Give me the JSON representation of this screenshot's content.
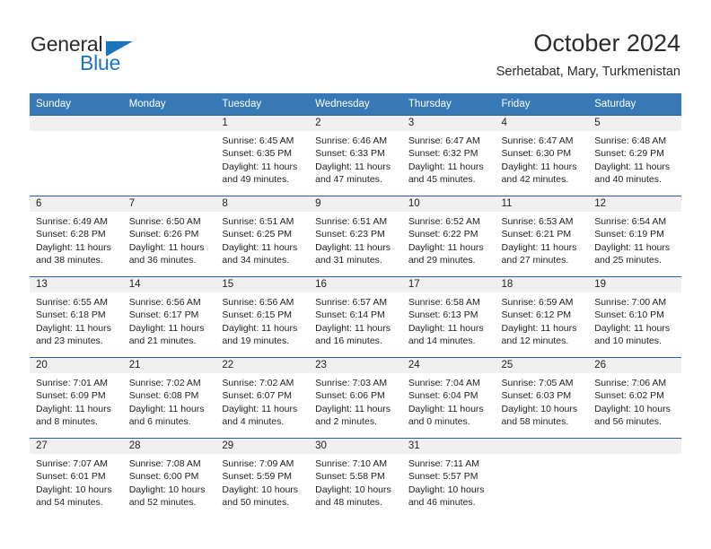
{
  "brand": {
    "name_part1": "General",
    "name_part2": "Blue",
    "accent_color": "#1b75bb"
  },
  "header": {
    "month_title": "October 2024",
    "location": "Serhetabat, Mary, Turkmenistan"
  },
  "theme": {
    "header_row_bg": "#3679b6",
    "daynum_band_bg": "#f0f0f0",
    "grid_line": "#2a6099",
    "text": "#222222"
  },
  "weekday_headers": [
    "Sunday",
    "Monday",
    "Tuesday",
    "Wednesday",
    "Thursday",
    "Friday",
    "Saturday"
  ],
  "weeks": [
    [
      {
        "day": "",
        "empty": true
      },
      {
        "day": "",
        "empty": true
      },
      {
        "day": "1",
        "sunrise": "Sunrise: 6:45 AM",
        "sunset": "Sunset: 6:35 PM",
        "daylight_line1": "Daylight: 11 hours",
        "daylight_line2": "and 49 minutes."
      },
      {
        "day": "2",
        "sunrise": "Sunrise: 6:46 AM",
        "sunset": "Sunset: 6:33 PM",
        "daylight_line1": "Daylight: 11 hours",
        "daylight_line2": "and 47 minutes."
      },
      {
        "day": "3",
        "sunrise": "Sunrise: 6:47 AM",
        "sunset": "Sunset: 6:32 PM",
        "daylight_line1": "Daylight: 11 hours",
        "daylight_line2": "and 45 minutes."
      },
      {
        "day": "4",
        "sunrise": "Sunrise: 6:47 AM",
        "sunset": "Sunset: 6:30 PM",
        "daylight_line1": "Daylight: 11 hours",
        "daylight_line2": "and 42 minutes."
      },
      {
        "day": "5",
        "sunrise": "Sunrise: 6:48 AM",
        "sunset": "Sunset: 6:29 PM",
        "daylight_line1": "Daylight: 11 hours",
        "daylight_line2": "and 40 minutes."
      }
    ],
    [
      {
        "day": "6",
        "sunrise": "Sunrise: 6:49 AM",
        "sunset": "Sunset: 6:28 PM",
        "daylight_line1": "Daylight: 11 hours",
        "daylight_line2": "and 38 minutes."
      },
      {
        "day": "7",
        "sunrise": "Sunrise: 6:50 AM",
        "sunset": "Sunset: 6:26 PM",
        "daylight_line1": "Daylight: 11 hours",
        "daylight_line2": "and 36 minutes."
      },
      {
        "day": "8",
        "sunrise": "Sunrise: 6:51 AM",
        "sunset": "Sunset: 6:25 PM",
        "daylight_line1": "Daylight: 11 hours",
        "daylight_line2": "and 34 minutes."
      },
      {
        "day": "9",
        "sunrise": "Sunrise: 6:51 AM",
        "sunset": "Sunset: 6:23 PM",
        "daylight_line1": "Daylight: 11 hours",
        "daylight_line2": "and 31 minutes."
      },
      {
        "day": "10",
        "sunrise": "Sunrise: 6:52 AM",
        "sunset": "Sunset: 6:22 PM",
        "daylight_line1": "Daylight: 11 hours",
        "daylight_line2": "and 29 minutes."
      },
      {
        "day": "11",
        "sunrise": "Sunrise: 6:53 AM",
        "sunset": "Sunset: 6:21 PM",
        "daylight_line1": "Daylight: 11 hours",
        "daylight_line2": "and 27 minutes."
      },
      {
        "day": "12",
        "sunrise": "Sunrise: 6:54 AM",
        "sunset": "Sunset: 6:19 PM",
        "daylight_line1": "Daylight: 11 hours",
        "daylight_line2": "and 25 minutes."
      }
    ],
    [
      {
        "day": "13",
        "sunrise": "Sunrise: 6:55 AM",
        "sunset": "Sunset: 6:18 PM",
        "daylight_line1": "Daylight: 11 hours",
        "daylight_line2": "and 23 minutes."
      },
      {
        "day": "14",
        "sunrise": "Sunrise: 6:56 AM",
        "sunset": "Sunset: 6:17 PM",
        "daylight_line1": "Daylight: 11 hours",
        "daylight_line2": "and 21 minutes."
      },
      {
        "day": "15",
        "sunrise": "Sunrise: 6:56 AM",
        "sunset": "Sunset: 6:15 PM",
        "daylight_line1": "Daylight: 11 hours",
        "daylight_line2": "and 19 minutes."
      },
      {
        "day": "16",
        "sunrise": "Sunrise: 6:57 AM",
        "sunset": "Sunset: 6:14 PM",
        "daylight_line1": "Daylight: 11 hours",
        "daylight_line2": "and 16 minutes."
      },
      {
        "day": "17",
        "sunrise": "Sunrise: 6:58 AM",
        "sunset": "Sunset: 6:13 PM",
        "daylight_line1": "Daylight: 11 hours",
        "daylight_line2": "and 14 minutes."
      },
      {
        "day": "18",
        "sunrise": "Sunrise: 6:59 AM",
        "sunset": "Sunset: 6:12 PM",
        "daylight_line1": "Daylight: 11 hours",
        "daylight_line2": "and 12 minutes."
      },
      {
        "day": "19",
        "sunrise": "Sunrise: 7:00 AM",
        "sunset": "Sunset: 6:10 PM",
        "daylight_line1": "Daylight: 11 hours",
        "daylight_line2": "and 10 minutes."
      }
    ],
    [
      {
        "day": "20",
        "sunrise": "Sunrise: 7:01 AM",
        "sunset": "Sunset: 6:09 PM",
        "daylight_line1": "Daylight: 11 hours",
        "daylight_line2": "and 8 minutes."
      },
      {
        "day": "21",
        "sunrise": "Sunrise: 7:02 AM",
        "sunset": "Sunset: 6:08 PM",
        "daylight_line1": "Daylight: 11 hours",
        "daylight_line2": "and 6 minutes."
      },
      {
        "day": "22",
        "sunrise": "Sunrise: 7:02 AM",
        "sunset": "Sunset: 6:07 PM",
        "daylight_line1": "Daylight: 11 hours",
        "daylight_line2": "and 4 minutes."
      },
      {
        "day": "23",
        "sunrise": "Sunrise: 7:03 AM",
        "sunset": "Sunset: 6:06 PM",
        "daylight_line1": "Daylight: 11 hours",
        "daylight_line2": "and 2 minutes."
      },
      {
        "day": "24",
        "sunrise": "Sunrise: 7:04 AM",
        "sunset": "Sunset: 6:04 PM",
        "daylight_line1": "Daylight: 11 hours",
        "daylight_line2": "and 0 minutes."
      },
      {
        "day": "25",
        "sunrise": "Sunrise: 7:05 AM",
        "sunset": "Sunset: 6:03 PM",
        "daylight_line1": "Daylight: 10 hours",
        "daylight_line2": "and 58 minutes."
      },
      {
        "day": "26",
        "sunrise": "Sunrise: 7:06 AM",
        "sunset": "Sunset: 6:02 PM",
        "daylight_line1": "Daylight: 10 hours",
        "daylight_line2": "and 56 minutes."
      }
    ],
    [
      {
        "day": "27",
        "sunrise": "Sunrise: 7:07 AM",
        "sunset": "Sunset: 6:01 PM",
        "daylight_line1": "Daylight: 10 hours",
        "daylight_line2": "and 54 minutes."
      },
      {
        "day": "28",
        "sunrise": "Sunrise: 7:08 AM",
        "sunset": "Sunset: 6:00 PM",
        "daylight_line1": "Daylight: 10 hours",
        "daylight_line2": "and 52 minutes."
      },
      {
        "day": "29",
        "sunrise": "Sunrise: 7:09 AM",
        "sunset": "Sunset: 5:59 PM",
        "daylight_line1": "Daylight: 10 hours",
        "daylight_line2": "and 50 minutes."
      },
      {
        "day": "30",
        "sunrise": "Sunrise: 7:10 AM",
        "sunset": "Sunset: 5:58 PM",
        "daylight_line1": "Daylight: 10 hours",
        "daylight_line2": "and 48 minutes."
      },
      {
        "day": "31",
        "sunrise": "Sunrise: 7:11 AM",
        "sunset": "Sunset: 5:57 PM",
        "daylight_line1": "Daylight: 10 hours",
        "daylight_line2": "and 46 minutes."
      },
      {
        "day": "",
        "empty": true
      },
      {
        "day": "",
        "empty": true
      }
    ]
  ]
}
